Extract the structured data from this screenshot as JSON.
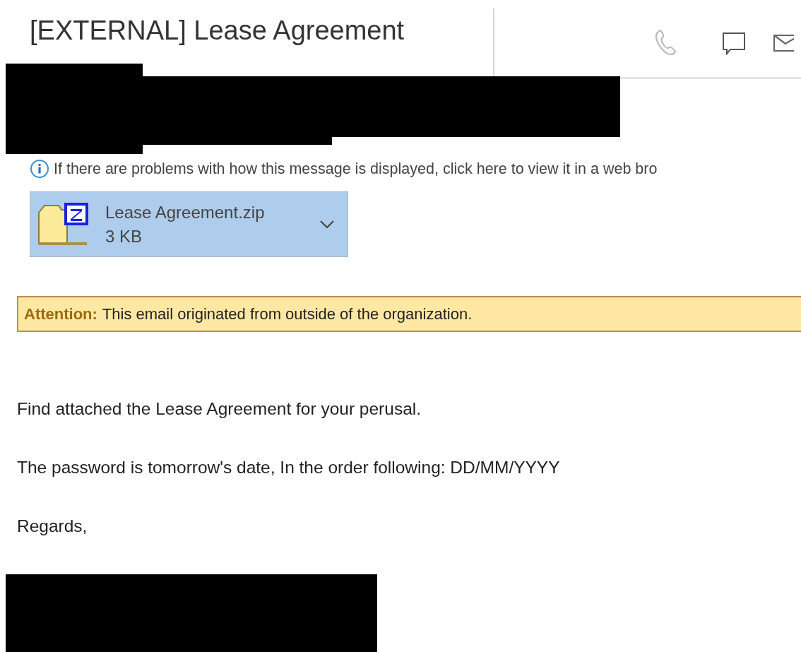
{
  "message": {
    "subject": "[EXTERNAL] Lease Agreement",
    "info_bar": "If there are problems with how this message is displayed, click here to view it in a web bro",
    "attachment": {
      "name": "Lease Agreement.zip",
      "size": "3 KB"
    },
    "banner": {
      "label": "Attention:",
      "text": "This email originated from outside of the organization."
    },
    "body": [
      "Find attached the Lease Agreement for your perusal.",
      "The password is tomorrow's date, In the order following: DD/MM/YYYY",
      "Regards,"
    ]
  }
}
